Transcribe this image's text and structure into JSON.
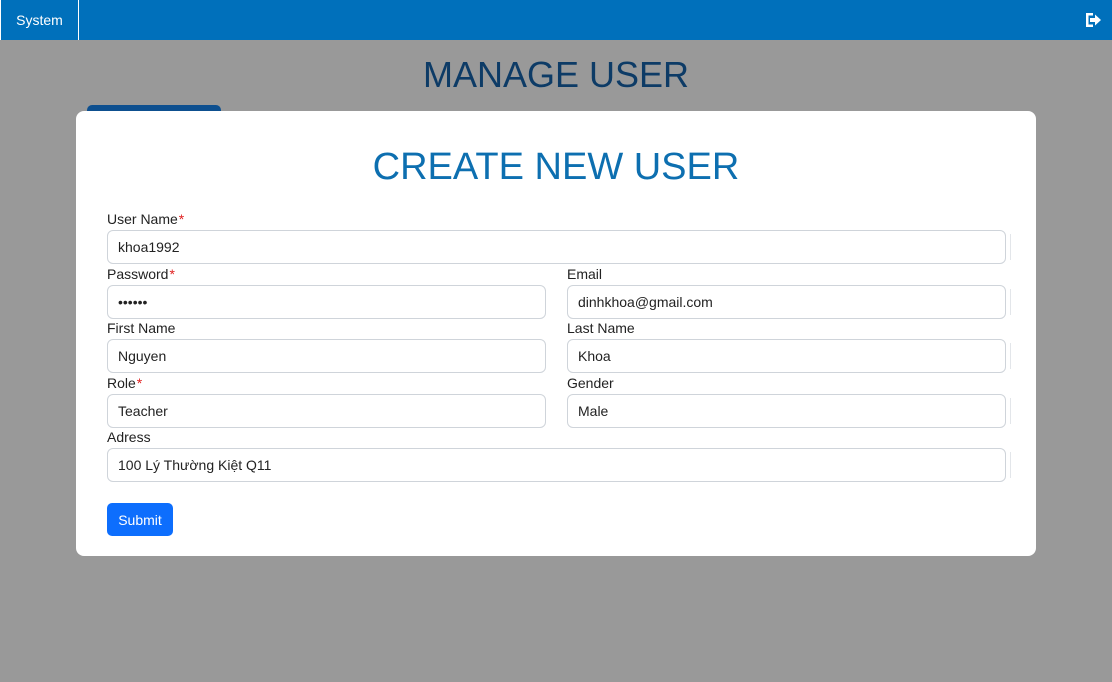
{
  "topbar": {
    "system_tab": "System",
    "logout_icon": "sign-out-icon",
    "accent": "#0070bb"
  },
  "page": {
    "title": "MANAGE USER"
  },
  "modal": {
    "title": "CREATE NEW USER",
    "fields": {
      "username": {
        "label": "User Name",
        "required": "*",
        "value": "khoa1992"
      },
      "password": {
        "label": "Password",
        "required": "*",
        "value": "khoa12"
      },
      "email": {
        "label": "Email",
        "value": "dinhkhoa@gmail.com"
      },
      "first_name": {
        "label": "First Name",
        "value": "Nguyen"
      },
      "last_name": {
        "label": "Last Name",
        "value": "Khoa"
      },
      "role": {
        "label": "Role",
        "required": "*",
        "value": "Teacher"
      },
      "gender": {
        "label": "Gender",
        "value": "Male"
      },
      "address": {
        "label": "Adress",
        "value": "100 Lý Thường Kiệt Q11"
      }
    },
    "submit_label": "Submit",
    "submit_color": "#0d6efd"
  }
}
